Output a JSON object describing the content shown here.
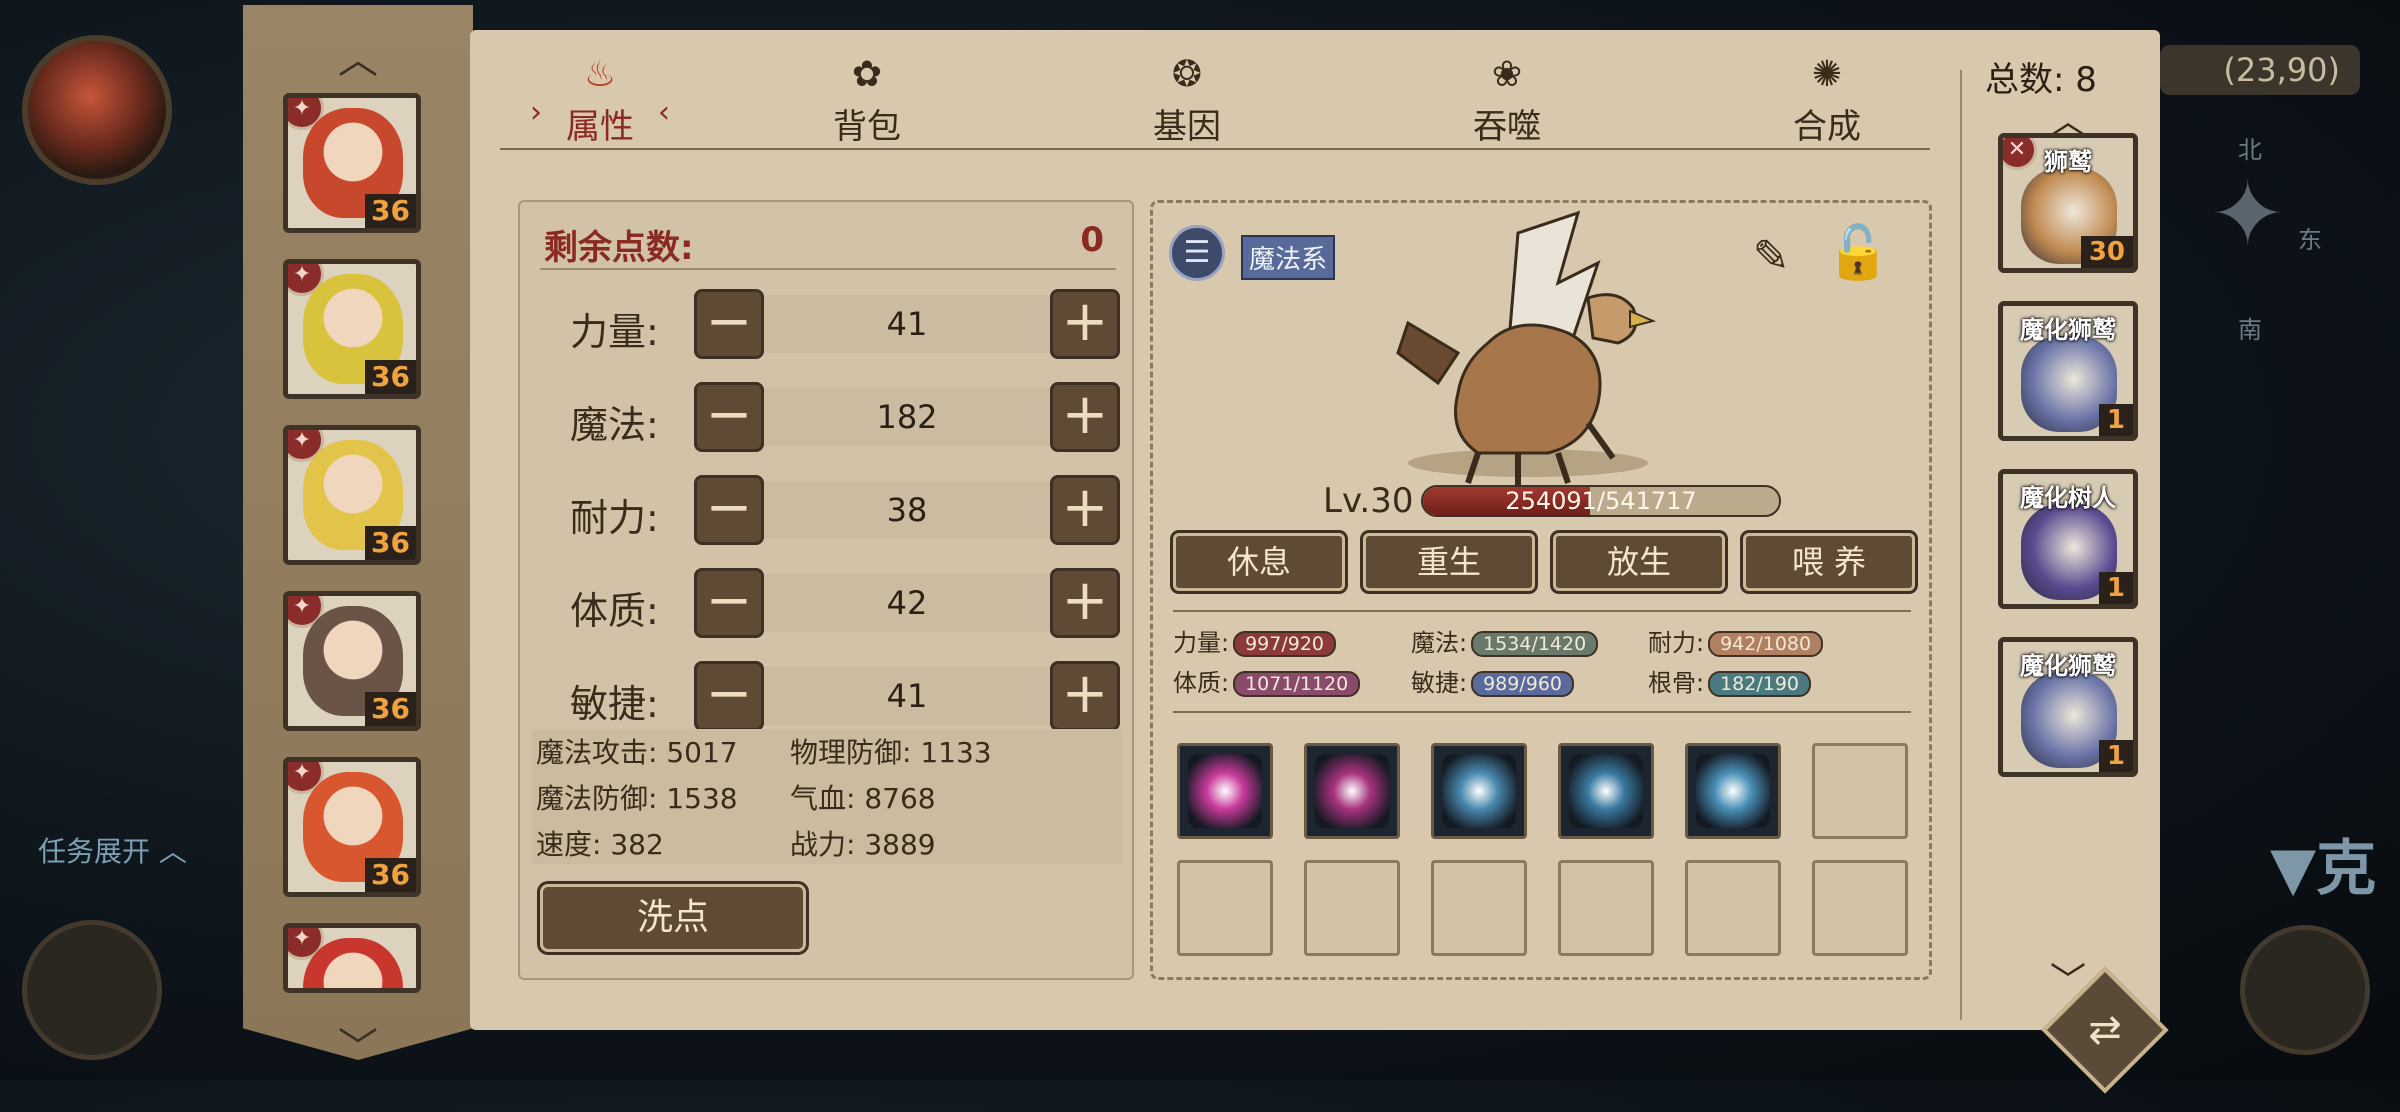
{
  "background": {
    "coords": "(23,90)",
    "compass": {
      "north": "北",
      "east": "东",
      "south": "南"
    },
    "task_toggle": "任务展开",
    "right_partial_text": "▼克"
  },
  "tabs": [
    {
      "label": "属性",
      "icon": "flame-icon",
      "active": true
    },
    {
      "label": "背包",
      "icon": "bag-icon",
      "active": false
    },
    {
      "label": "基因",
      "icon": "gene-icon",
      "active": false
    },
    {
      "label": "吞噬",
      "icon": "devour-icon",
      "active": false
    },
    {
      "label": "合成",
      "icon": "synthesis-icon",
      "active": false
    }
  ],
  "heroes": [
    {
      "level": "36",
      "color": "#c8482e"
    },
    {
      "level": "36",
      "color": "#d9c23c"
    },
    {
      "level": "36",
      "color": "#e2c44a"
    },
    {
      "level": "36",
      "color": "#6a5448"
    },
    {
      "level": "36",
      "color": "#d8572f"
    },
    {
      "level": "",
      "color": "#c8362e"
    }
  ],
  "attributes": {
    "remaining_label": "剩余点数:",
    "remaining_value": "0",
    "rows": [
      {
        "label": "力量:",
        "value": "41"
      },
      {
        "label": "魔法:",
        "value": "182"
      },
      {
        "label": "耐力:",
        "value": "38"
      },
      {
        "label": "体质:",
        "value": "42"
      },
      {
        "label": "敏捷:",
        "value": "41"
      }
    ],
    "derived": {
      "magic_attack": "魔法攻击: 5017",
      "physical_defense": "物理防御: 1133",
      "magic_defense": "魔法防御: 1538",
      "hp": "气血: 8768",
      "speed": "速度: 382",
      "power": "战力: 3889"
    },
    "wash_button": "洗点"
  },
  "pet": {
    "element": "魔法系",
    "level": "Lv.30",
    "hp_text": "254091/541717",
    "hp_fraction": 0.469,
    "buttons": [
      "休息",
      "重生",
      "放生",
      "喂 养"
    ],
    "stats": [
      {
        "label": "力量:",
        "value": "997/920",
        "color": "#8a3a3a"
      },
      {
        "label": "魔法:",
        "value": "1534/1420",
        "color": "#6a7a6a"
      },
      {
        "label": "耐力:",
        "value": "942/1080",
        "color": "#b08060"
      },
      {
        "label": "体质:",
        "value": "1071/1120",
        "color": "#8a4a6a"
      },
      {
        "label": "敏捷:",
        "value": "989/960",
        "color": "#5a6a9a"
      },
      {
        "label": "根骨:",
        "value": "182/190",
        "color": "#4a7a80"
      }
    ],
    "skills": [
      {
        "icon": "pink-burst-icon",
        "color": "#c83a9a"
      },
      {
        "icon": "pink-spikes-icon",
        "color": "#a8327e"
      },
      {
        "icon": "ice-swirl-icon",
        "color": "#4a8ab0"
      },
      {
        "icon": "frost-ring-icon",
        "color": "#3a7aa0"
      },
      {
        "icon": "ice-shards-icon",
        "color": "#4a90b8"
      }
    ]
  },
  "pet_list": {
    "total": "总数: 8",
    "items": [
      {
        "name": "狮鹫",
        "count": "30",
        "color": "#c08a50"
      },
      {
        "name": "魔化狮鹫",
        "count": "1",
        "color": "#6a74a8"
      },
      {
        "name": "魔化树人",
        "count": "1",
        "color": "#5a4a90"
      },
      {
        "name": "魔化狮鹫",
        "count": "1",
        "color": "#6a74a8"
      }
    ]
  }
}
